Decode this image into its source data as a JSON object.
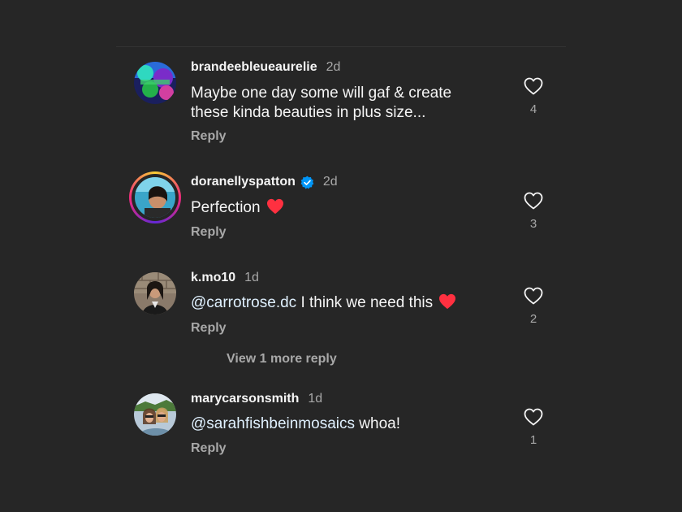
{
  "colors": {
    "background": "#262626",
    "primary_text": "#f5f5f5",
    "secondary_text": "#a8a8a8",
    "verified_badge": "#0095f6",
    "heart_emoji": "#ff3040"
  },
  "comments": [
    {
      "username": "brandeebleueaurelie",
      "time": "2d",
      "verified": false,
      "text_lines": [
        "Maybe one day some will gaf & create",
        "these kinda beauties in plus size..."
      ],
      "reply_label": "Reply",
      "likes": "4",
      "avatar_icon": "avatar-image"
    },
    {
      "username": "doranellyspatton",
      "time": "2d",
      "verified": true,
      "text": "Perfection",
      "emoji": "red-heart-emoji",
      "reply_label": "Reply",
      "likes": "3",
      "avatar_icon": "avatar-image-story-ring"
    },
    {
      "username": "k.mo10",
      "time": "1d",
      "verified": false,
      "mention": "@carrotrose.dc",
      "text": " I think we need this",
      "emoji": "red-heart-emoji",
      "reply_label": "Reply",
      "likes": "2",
      "avatar_icon": "avatar-image",
      "view_more_label": "View 1 more reply"
    },
    {
      "username": "marycarsonsmith",
      "time": "1d",
      "verified": false,
      "mention": "@sarahfishbeinmosaics",
      "text": " whoa!",
      "reply_label": "Reply",
      "likes": "1",
      "avatar_icon": "avatar-image"
    }
  ],
  "icons": {
    "like": "heart-outline-icon",
    "verified": "verified-badge-icon"
  }
}
